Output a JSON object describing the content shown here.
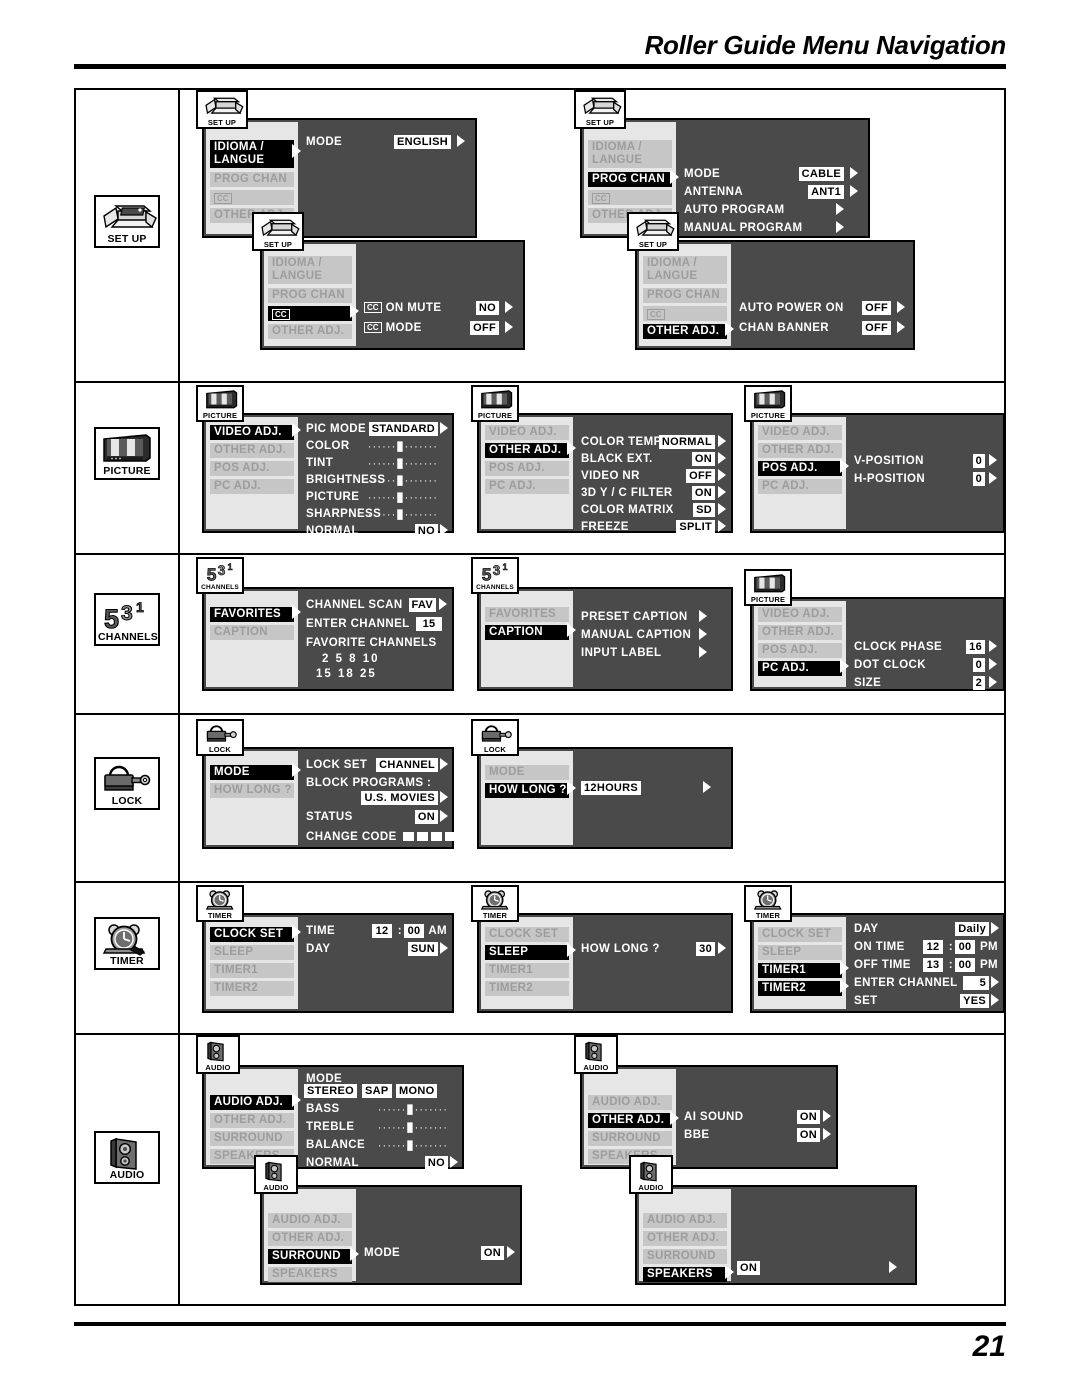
{
  "header": {
    "title": "Roller Guide Menu Navigation"
  },
  "footer": {
    "page_number": "21"
  },
  "categories": [
    {
      "id": "set-up",
      "label": "SET UP",
      "icon": "open-box-icon"
    },
    {
      "id": "picture",
      "label": "PICTURE",
      "icon": "tv-screen-icon"
    },
    {
      "id": "channels",
      "label": "CHANNELS",
      "icon": "channel-numbers-icon"
    },
    {
      "id": "lock",
      "label": "LOCK",
      "icon": "padlock-key-icon"
    },
    {
      "id": "timer",
      "label": "TIMER",
      "icon": "alarm-clock-icon"
    },
    {
      "id": "audio",
      "label": "AUDIO",
      "icon": "speaker-icon"
    }
  ],
  "setup": {
    "menu_items": [
      "IDIOMA /",
      "LANGUE",
      "PROG CHAN",
      "CC",
      "OTHER ADJ."
    ],
    "panel1": {
      "badge": "SET UP",
      "selected": "IDIOMA / LANGUE",
      "rows": [
        {
          "label": "MODE",
          "value": "ENGLISH"
        }
      ]
    },
    "panel2": {
      "badge": "SET UP",
      "selected": "CC",
      "rows": [
        {
          "icon": "CC",
          "label": "ON MUTE",
          "value": "NO"
        },
        {
          "icon": "CC",
          "label": "MODE",
          "value": "OFF"
        }
      ]
    },
    "panel3": {
      "badge": "SET UP",
      "selected": "PROG CHAN",
      "rows": [
        {
          "label": "MODE",
          "value": "CABLE"
        },
        {
          "label": "ANTENNA",
          "value": "ANT1"
        },
        {
          "label": "AUTO PROGRAM",
          "value": ""
        },
        {
          "label": "MANUAL PROGRAM",
          "value": ""
        }
      ]
    },
    "panel4": {
      "badge": "SET UP",
      "selected": "OTHER ADJ.",
      "rows": [
        {
          "label": "AUTO POWER ON",
          "value": "OFF"
        },
        {
          "label": "CHAN BANNER",
          "value": "OFF"
        }
      ]
    }
  },
  "picture": {
    "menu_items": [
      "VIDEO ADJ.",
      "OTHER ADJ.",
      "POS ADJ.",
      "PC ADJ."
    ],
    "panel1": {
      "badge": "PICTURE",
      "selected": "VIDEO ADJ.",
      "rows": [
        {
          "label": "PIC MODE",
          "value": "STANDARD"
        },
        {
          "label": "COLOR",
          "value": "slider"
        },
        {
          "label": "TINT",
          "value": "slider"
        },
        {
          "label": "BRIGHTNESS",
          "value": "slider"
        },
        {
          "label": "PICTURE",
          "value": "slider"
        },
        {
          "label": "SHARPNESS",
          "value": "slider"
        },
        {
          "label": "NORMAL",
          "value": "NO"
        }
      ]
    },
    "panel2": {
      "badge": "PICTURE",
      "selected": "OTHER ADJ.",
      "rows": [
        {
          "label": "COLOR TEMP",
          "value": "NORMAL"
        },
        {
          "label": "BLACK EXT.",
          "value": "ON"
        },
        {
          "label": "VIDEO NR",
          "value": "OFF"
        },
        {
          "label": "3D Y / C FILTER",
          "value": "ON"
        },
        {
          "label": "COLOR MATRIX",
          "value": "SD"
        },
        {
          "label": "FREEZE",
          "value": "SPLIT"
        }
      ]
    },
    "panel3": {
      "badge": "PICTURE",
      "selected": "POS ADJ.",
      "rows": [
        {
          "label": "V-POSITION",
          "value": "0"
        },
        {
          "label": "H-POSITION",
          "value": "0"
        }
      ]
    },
    "panel4": {
      "badge": "PICTURE",
      "selected": "PC ADJ.",
      "rows": [
        {
          "label": "CLOCK PHASE",
          "value": "16"
        },
        {
          "label": "DOT CLOCK",
          "value": "0"
        },
        {
          "label": "SIZE",
          "value": "2"
        }
      ]
    }
  },
  "channels": {
    "menu_items": [
      "FAVORITES",
      "CAPTION"
    ],
    "panel1": {
      "badge": "CHANNELS",
      "selected": "FAVORITES",
      "rows": [
        {
          "label": "CHANNEL SCAN",
          "value": "FAV"
        },
        {
          "label": "ENTER CHANNEL",
          "value": "15"
        },
        {
          "label": "FAVORITE CHANNELS",
          "value": ""
        }
      ],
      "favorite_channels_line1": "2    5    8   10",
      "favorite_channels_line2": "15  18  25"
    },
    "panel2": {
      "badge": "CHANNELS",
      "selected": "CAPTION",
      "rows": [
        {
          "label": "PRESET CAPTION",
          "value": ""
        },
        {
          "label": "MANUAL CAPTION",
          "value": ""
        },
        {
          "label": "INPUT LABEL",
          "value": ""
        }
      ]
    }
  },
  "lock": {
    "menu_items": [
      "MODE",
      "HOW LONG ?"
    ],
    "panel1": {
      "badge": "LOCK",
      "selected": "MODE",
      "rows": [
        {
          "label": "LOCK SET",
          "value": "CHANNEL"
        },
        {
          "label": "BLOCK PROGRAMS :",
          "value": "U.S. MOVIES"
        },
        {
          "label": "STATUS",
          "value": "ON"
        },
        {
          "label": "CHANGE CODE",
          "value": "----"
        }
      ]
    },
    "panel2": {
      "badge": "LOCK",
      "selected": "HOW LONG ?",
      "rows": [
        {
          "label": "",
          "value": "12HOURS"
        }
      ]
    }
  },
  "timer": {
    "menu_items": [
      "CLOCK SET",
      "SLEEP",
      "TIMER1",
      "TIMER2"
    ],
    "panel1": {
      "badge": "TIMER",
      "selected": "CLOCK SET",
      "rows": [
        {
          "label": "TIME",
          "value": "12 : 00 AM",
          "hours": "12",
          "minutes": "00",
          "meridiem": "AM"
        },
        {
          "label": "DAY",
          "value": "SUN"
        }
      ]
    },
    "panel2": {
      "badge": "TIMER",
      "selected": "SLEEP",
      "rows": [
        {
          "label": "HOW LONG ?",
          "value": "30"
        }
      ]
    },
    "panel3": {
      "badge": "TIMER",
      "selected": "TIMER1",
      "rows": [
        {
          "label": "DAY",
          "value": "Daily"
        },
        {
          "label": "ON TIME",
          "hours": "12",
          "minutes": "00",
          "meridiem": "PM"
        },
        {
          "label": "OFF TIME",
          "hours": "13",
          "minutes": "00",
          "meridiem": "PM"
        },
        {
          "label": "ENTER CHANNEL",
          "value": "5"
        },
        {
          "label": "SET",
          "value": "YES"
        }
      ]
    }
  },
  "audio": {
    "menu_items": [
      "AUDIO ADJ.",
      "OTHER ADJ.",
      "SURROUND",
      "SPEAKERS"
    ],
    "panel1": {
      "badge": "AUDIO",
      "selected": "AUDIO ADJ.",
      "mode_label": "MODE",
      "mode_options": [
        "STEREO",
        "SAP",
        "MONO"
      ],
      "rows": [
        {
          "label": "BASS",
          "value": "slider"
        },
        {
          "label": "TREBLE",
          "value": "slider"
        },
        {
          "label": "BALANCE",
          "value": "slider"
        },
        {
          "label": "NORMAL",
          "value": "NO"
        }
      ]
    },
    "panel2": {
      "badge": "AUDIO",
      "selected": "OTHER ADJ.",
      "rows": [
        {
          "label": "AI SOUND",
          "value": "ON"
        },
        {
          "label": "BBE",
          "value": "ON"
        }
      ]
    },
    "panel3": {
      "badge": "AUDIO",
      "selected": "SURROUND",
      "rows": [
        {
          "label": "MODE",
          "value": "ON"
        }
      ]
    },
    "panel4": {
      "badge": "AUDIO",
      "selected": "SPEAKERS",
      "rows": [
        {
          "label": "",
          "value": "ON"
        }
      ]
    }
  }
}
